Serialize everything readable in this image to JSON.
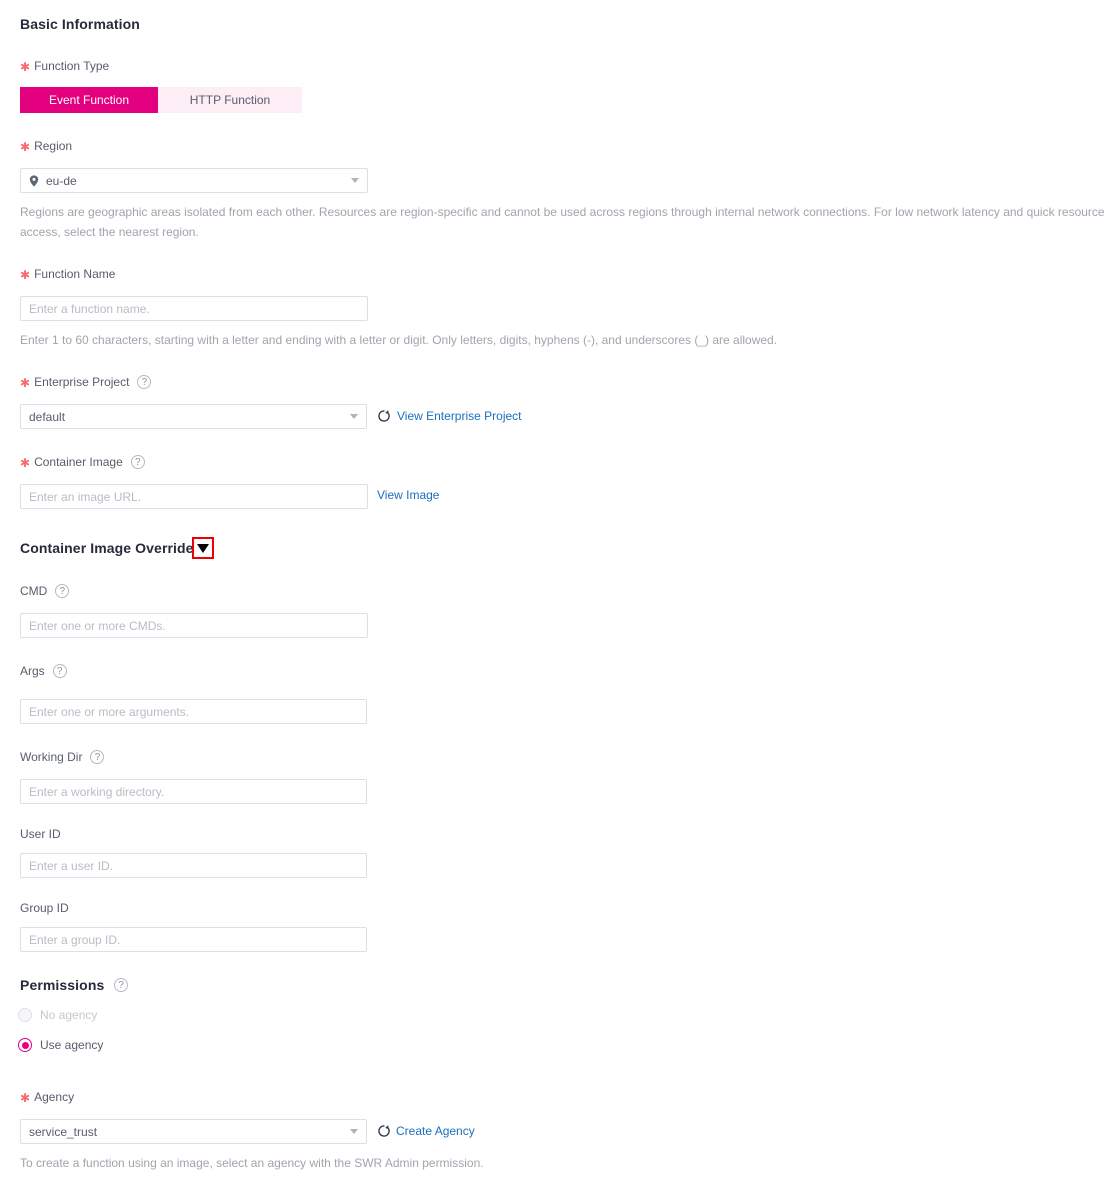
{
  "section": {
    "basic_information": "Basic Information",
    "container_image_override": "Container Image Override",
    "permissions": "Permissions"
  },
  "function_type": {
    "label": "Function Type",
    "required": true,
    "options": [
      "Event Function",
      "HTTP Function"
    ],
    "selected": "Event Function",
    "active_color": "#e3007f",
    "inactive_bg": "#fdeef6"
  },
  "region": {
    "label": "Region",
    "required": true,
    "value": "eu-de",
    "icon": "location-pin-icon",
    "hint": "Regions are geographic areas isolated from each other. Resources are region-specific and cannot be used across regions through internal network connections. For low network latency and quick resource access, select the nearest region."
  },
  "function_name": {
    "label": "Function Name",
    "required": true,
    "placeholder": "Enter a function name.",
    "value": "",
    "hint": "Enter 1 to 60 characters, starting with a letter and ending with a letter or digit. Only letters, digits, hyphens (-), and underscores (_) are allowed."
  },
  "enterprise_project": {
    "label": "Enterprise Project",
    "required": true,
    "help": "?",
    "value": "default",
    "refresh_icon": "refresh-icon",
    "link": "View Enterprise Project"
  },
  "container_image": {
    "label": "Container Image",
    "required": true,
    "help": "?",
    "placeholder": "Enter an image URL.",
    "value": "",
    "link": "View Image"
  },
  "override": {
    "collapse_icon": "▼",
    "cmd": {
      "label": "CMD",
      "help": "?",
      "placeholder": "Enter one or more CMDs.",
      "value": ""
    },
    "args": {
      "label": "Args",
      "help": "?",
      "placeholder": "Enter one or more arguments.",
      "value": ""
    },
    "working_dir": {
      "label": "Working Dir",
      "help": "?",
      "placeholder": "Enter a working directory.",
      "value": ""
    },
    "user_id": {
      "label": "User ID",
      "placeholder": "Enter a user ID.",
      "value": ""
    },
    "group_id": {
      "label": "Group ID",
      "placeholder": "Enter a group ID.",
      "value": ""
    }
  },
  "permissions": {
    "label": "Permissions",
    "help": "?",
    "options": [
      {
        "label": "No agency",
        "selected": false,
        "disabled": true
      },
      {
        "label": "Use agency",
        "selected": true,
        "disabled": false
      }
    ]
  },
  "agency": {
    "label": "Agency",
    "required": true,
    "value": "service_trust",
    "refresh_icon": "refresh-icon",
    "link": "Create Agency",
    "hint": "To create a function using an image, select an agency with the SWR Admin permission."
  }
}
